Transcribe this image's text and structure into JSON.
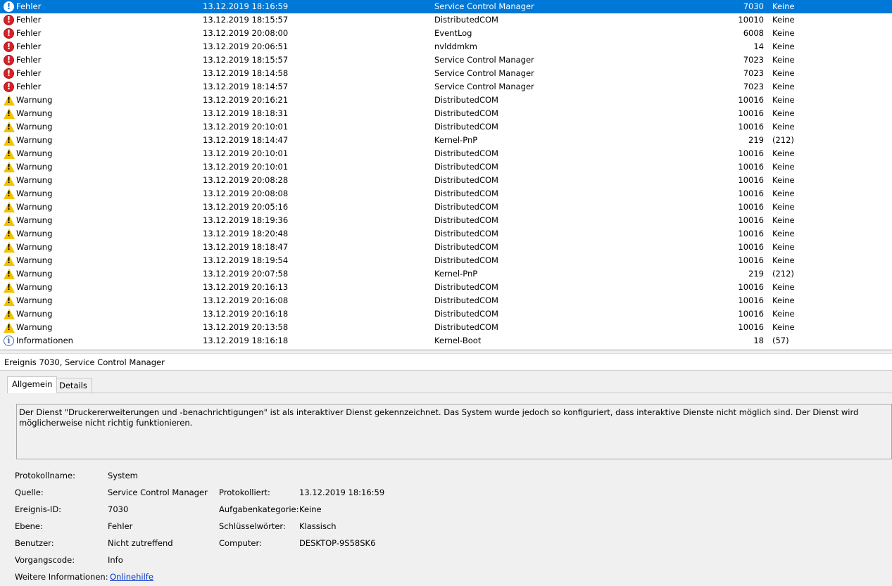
{
  "events": [
    {
      "level": "Fehler",
      "type": "error",
      "datetime": "13.12.2019 18:16:59",
      "source": "Service Control Manager",
      "id": "7030",
      "task": "Keine",
      "selected": true
    },
    {
      "level": "Fehler",
      "type": "error",
      "datetime": "13.12.2019 18:15:57",
      "source": "DistributedCOM",
      "id": "10010",
      "task": "Keine"
    },
    {
      "level": "Fehler",
      "type": "error",
      "datetime": "13.12.2019 20:08:00",
      "source": "EventLog",
      "id": "6008",
      "task": "Keine"
    },
    {
      "level": "Fehler",
      "type": "error",
      "datetime": "13.12.2019 20:06:51",
      "source": "nvlddmkm",
      "id": "14",
      "task": "Keine"
    },
    {
      "level": "Fehler",
      "type": "error",
      "datetime": "13.12.2019 18:15:57",
      "source": "Service Control Manager",
      "id": "7023",
      "task": "Keine"
    },
    {
      "level": "Fehler",
      "type": "error",
      "datetime": "13.12.2019 18:14:58",
      "source": "Service Control Manager",
      "id": "7023",
      "task": "Keine"
    },
    {
      "level": "Fehler",
      "type": "error",
      "datetime": "13.12.2019 18:14:57",
      "source": "Service Control Manager",
      "id": "7023",
      "task": "Keine"
    },
    {
      "level": "Warnung",
      "type": "warning",
      "datetime": "13.12.2019 20:16:21",
      "source": "DistributedCOM",
      "id": "10016",
      "task": "Keine"
    },
    {
      "level": "Warnung",
      "type": "warning",
      "datetime": "13.12.2019 18:18:31",
      "source": "DistributedCOM",
      "id": "10016",
      "task": "Keine"
    },
    {
      "level": "Warnung",
      "type": "warning",
      "datetime": "13.12.2019 20:10:01",
      "source": "DistributedCOM",
      "id": "10016",
      "task": "Keine"
    },
    {
      "level": "Warnung",
      "type": "warning",
      "datetime": "13.12.2019 18:14:47",
      "source": "Kernel-PnP",
      "id": "219",
      "task": "(212)"
    },
    {
      "level": "Warnung",
      "type": "warning",
      "datetime": "13.12.2019 20:10:01",
      "source": "DistributedCOM",
      "id": "10016",
      "task": "Keine"
    },
    {
      "level": "Warnung",
      "type": "warning",
      "datetime": "13.12.2019 20:10:01",
      "source": "DistributedCOM",
      "id": "10016",
      "task": "Keine"
    },
    {
      "level": "Warnung",
      "type": "warning",
      "datetime": "13.12.2019 20:08:28",
      "source": "DistributedCOM",
      "id": "10016",
      "task": "Keine"
    },
    {
      "level": "Warnung",
      "type": "warning",
      "datetime": "13.12.2019 20:08:08",
      "source": "DistributedCOM",
      "id": "10016",
      "task": "Keine"
    },
    {
      "level": "Warnung",
      "type": "warning",
      "datetime": "13.12.2019 20:05:16",
      "source": "DistributedCOM",
      "id": "10016",
      "task": "Keine"
    },
    {
      "level": "Warnung",
      "type": "warning",
      "datetime": "13.12.2019 18:19:36",
      "source": "DistributedCOM",
      "id": "10016",
      "task": "Keine"
    },
    {
      "level": "Warnung",
      "type": "warning",
      "datetime": "13.12.2019 18:20:48",
      "source": "DistributedCOM",
      "id": "10016",
      "task": "Keine"
    },
    {
      "level": "Warnung",
      "type": "warning",
      "datetime": "13.12.2019 18:18:47",
      "source": "DistributedCOM",
      "id": "10016",
      "task": "Keine"
    },
    {
      "level": "Warnung",
      "type": "warning",
      "datetime": "13.12.2019 18:19:54",
      "source": "DistributedCOM",
      "id": "10016",
      "task": "Keine"
    },
    {
      "level": "Warnung",
      "type": "warning",
      "datetime": "13.12.2019 20:07:58",
      "source": "Kernel-PnP",
      "id": "219",
      "task": "(212)"
    },
    {
      "level": "Warnung",
      "type": "warning",
      "datetime": "13.12.2019 20:16:13",
      "source": "DistributedCOM",
      "id": "10016",
      "task": "Keine"
    },
    {
      "level": "Warnung",
      "type": "warning",
      "datetime": "13.12.2019 20:16:08",
      "source": "DistributedCOM",
      "id": "10016",
      "task": "Keine"
    },
    {
      "level": "Warnung",
      "type": "warning",
      "datetime": "13.12.2019 20:16:18",
      "source": "DistributedCOM",
      "id": "10016",
      "task": "Keine"
    },
    {
      "level": "Warnung",
      "type": "warning",
      "datetime": "13.12.2019 20:13:58",
      "source": "DistributedCOM",
      "id": "10016",
      "task": "Keine"
    },
    {
      "level": "Informationen",
      "type": "info",
      "datetime": "13.12.2019 18:16:18",
      "source": "Kernel-Boot",
      "id": "18",
      "task": "(57)"
    }
  ],
  "detail": {
    "title": "Ereignis 7030, Service Control Manager",
    "tabs": {
      "general": "Allgemein",
      "details": "Details"
    },
    "description": "Der Dienst \"Druckererweiterungen und -benachrichtigungen\" ist als interaktiver Dienst gekennzeichnet. Das System wurde jedoch so konfiguriert, dass interaktive Dienste nicht möglich sind. Der Dienst wird möglicherweise nicht richtig funktionieren.",
    "labels": {
      "log_name": "Protokollname:",
      "source": "Quelle:",
      "event_id": "Ereignis-ID:",
      "level": "Ebene:",
      "user": "Benutzer:",
      "opcode": "Vorgangscode:",
      "more_info": "Weitere Informationen:",
      "logged": "Protokolliert:",
      "task_category": "Aufgabenkategorie:",
      "keywords": "Schlüsselwörter:",
      "computer": "Computer:"
    },
    "values": {
      "log_name": "System",
      "source": "Service Control Manager",
      "event_id": "7030",
      "level": "Fehler",
      "user": "Nicht zutreffend",
      "opcode": "Info",
      "more_info": "Onlinehilfe",
      "logged": "13.12.2019 18:16:59",
      "task_category": "Keine",
      "keywords": "Klassisch",
      "computer": "DESKTOP-9S58SK6"
    }
  },
  "colors": {
    "selection": "#0078d7",
    "error": "#d82027",
    "warning": "#f2c200",
    "info": "#4569b2",
    "link": "#0033cc"
  },
  "icons": {
    "error": "error-icon",
    "warning": "warning-icon",
    "info": "info-icon"
  }
}
